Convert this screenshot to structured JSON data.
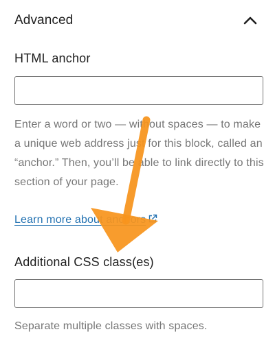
{
  "section": {
    "title": "Advanced",
    "toggle_icon": "chevron-up-icon"
  },
  "anchor": {
    "label": "HTML anchor",
    "value": "",
    "placeholder": "",
    "help_text": "Enter a word or two — without spaces — to make a unique web address just for this block, called an “anchor.” Then, you’ll be able to link directly to this section of your page.",
    "link_text": "Learn more about anchors",
    "link_icon": "external-link-icon"
  },
  "css_classes": {
    "label": "Additional CSS class(es)",
    "value": "",
    "placeholder": "",
    "help_text": "Separate multiple classes with spaces."
  },
  "annotation": {
    "arrow_icon": "arrow-down-icon",
    "color": "#f7941d"
  }
}
